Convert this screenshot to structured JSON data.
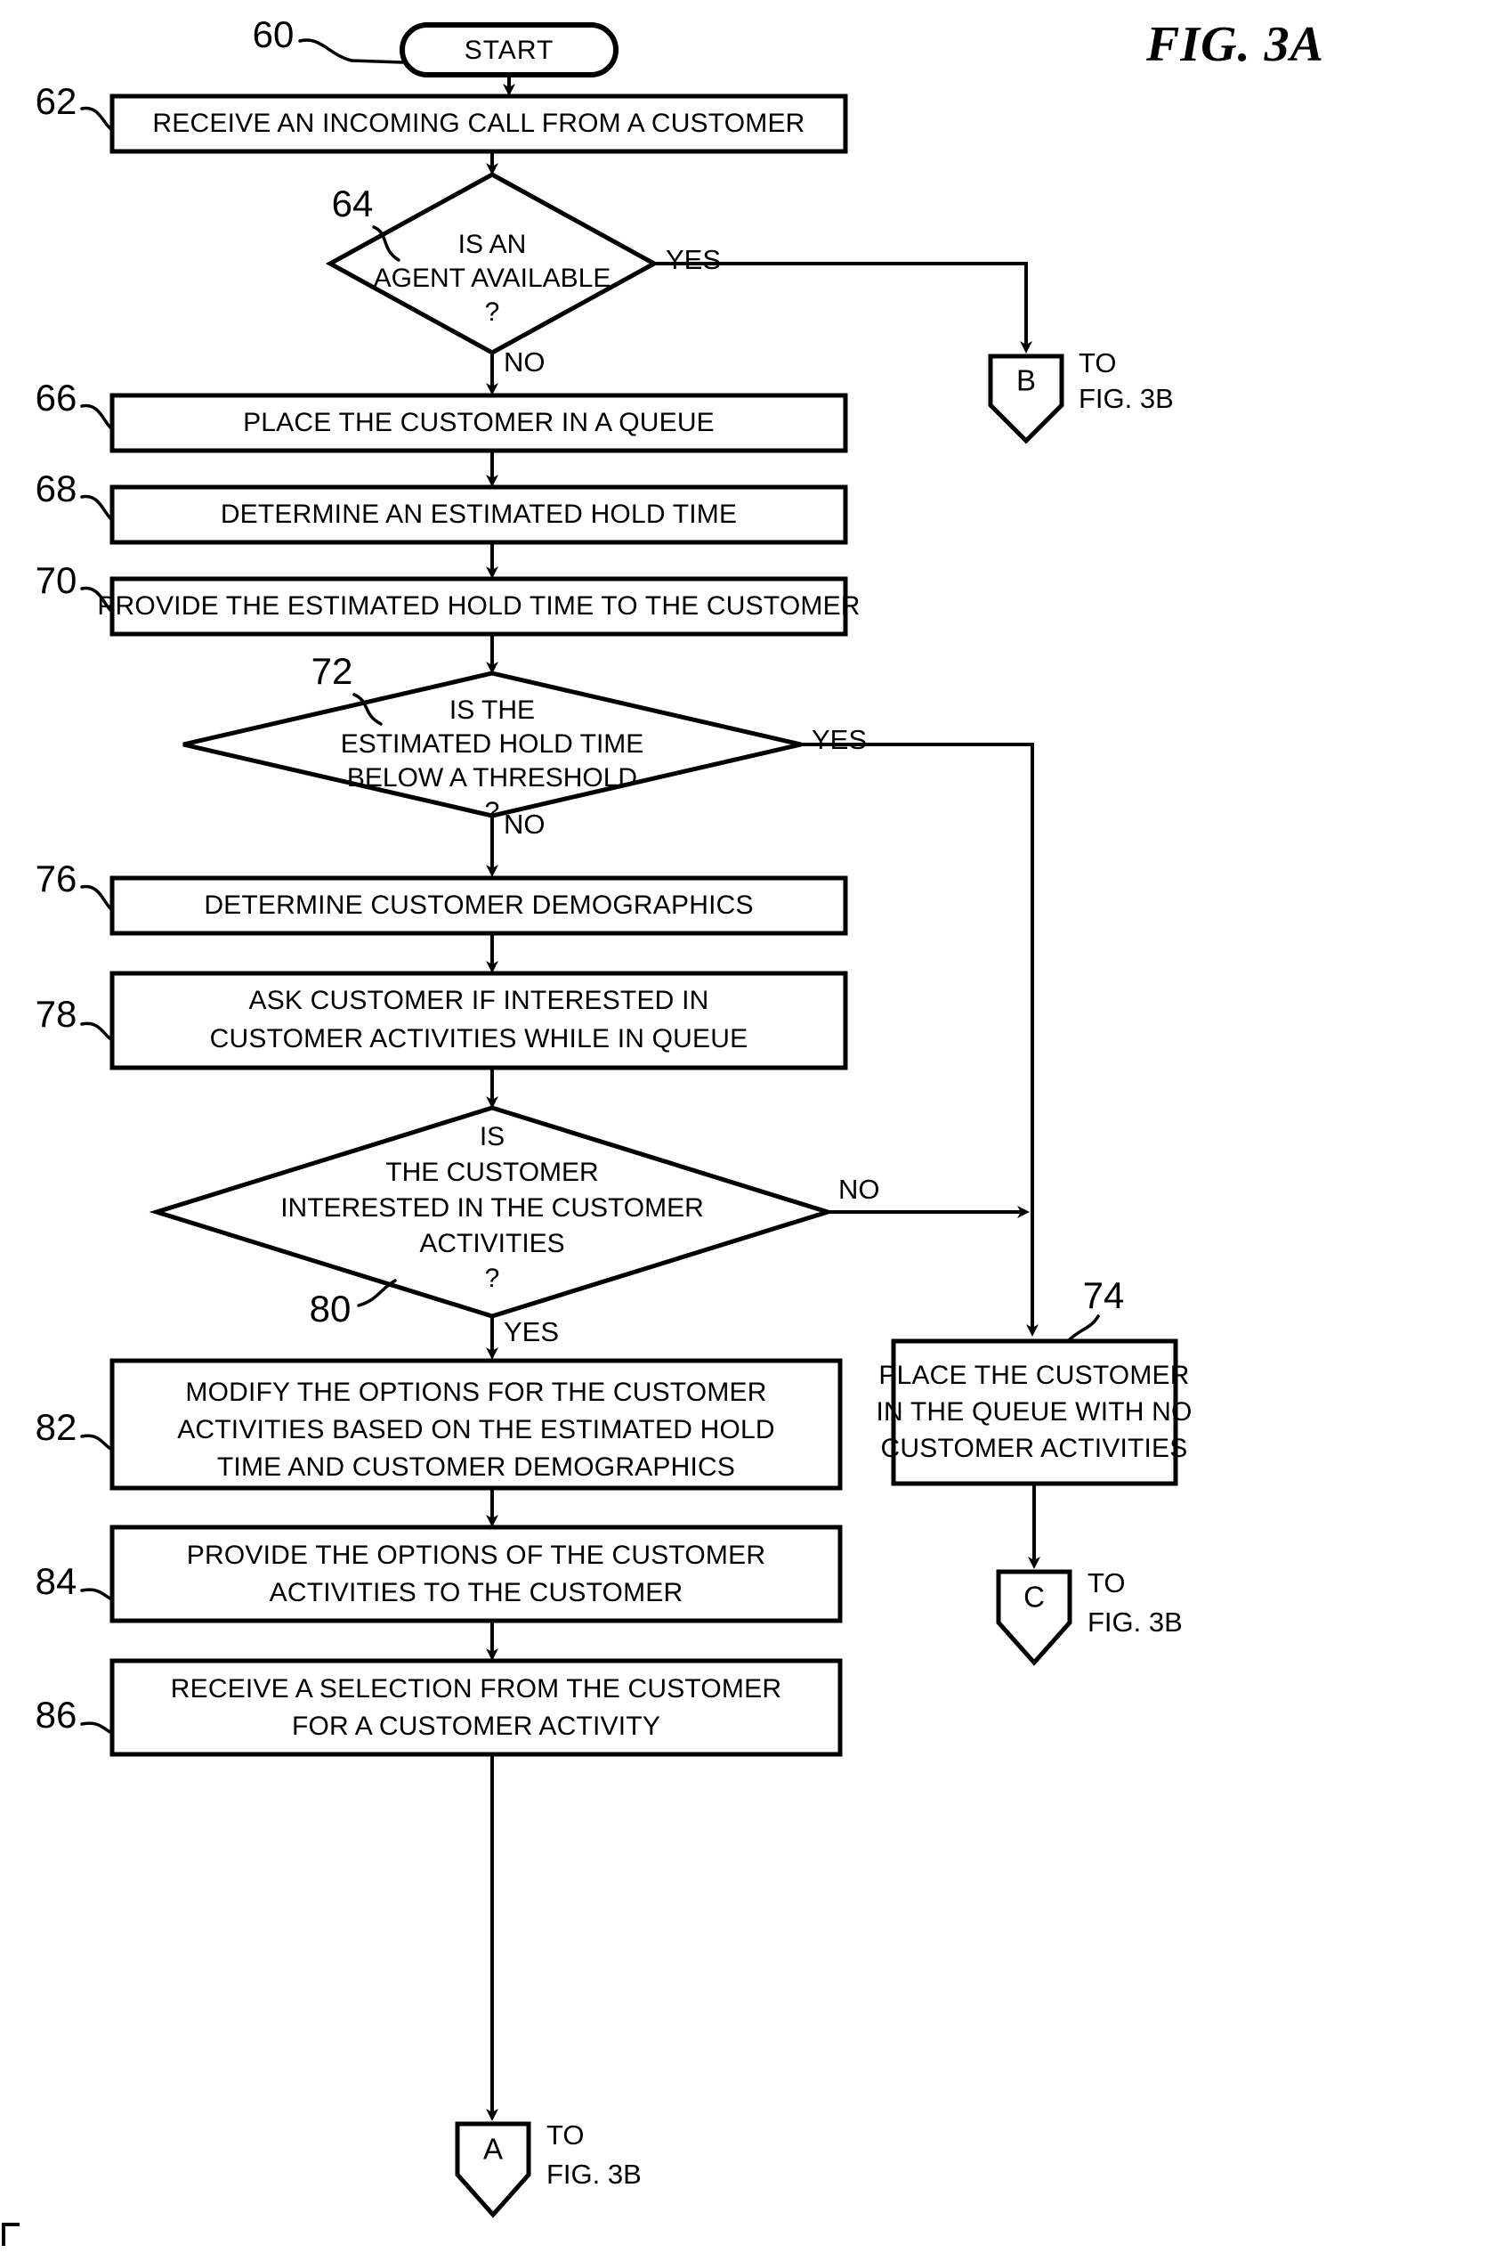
{
  "figure": {
    "title": "FIG. 3A",
    "page_edge_mark": true
  },
  "nodes": {
    "start": {
      "ref": "60",
      "type": "terminal",
      "label": "START"
    },
    "n62": {
      "ref": "62",
      "type": "process",
      "lines": [
        "RECEIVE AN INCOMING CALL FROM A CUSTOMER"
      ]
    },
    "n64": {
      "ref": "64",
      "type": "decision",
      "lines": [
        "IS AN",
        "AGENT AVAILABLE",
        "?"
      ],
      "branch_yes": "YES",
      "branch_no": "NO"
    },
    "n66": {
      "ref": "66",
      "type": "process",
      "lines": [
        "PLACE THE CUSTOMER IN A QUEUE"
      ]
    },
    "n68": {
      "ref": "68",
      "type": "process",
      "lines": [
        "DETERMINE AN ESTIMATED HOLD TIME"
      ]
    },
    "n70": {
      "ref": "70",
      "type": "process",
      "lines": [
        "PROVIDE THE ESTIMATED HOLD TIME TO THE CUSTOMER"
      ]
    },
    "n72": {
      "ref": "72",
      "type": "decision",
      "lines": [
        "IS THE",
        "ESTIMATED HOLD TIME",
        "BELOW A THRESHOLD",
        "?"
      ],
      "branch_yes": "YES",
      "branch_no": "NO"
    },
    "n76": {
      "ref": "76",
      "type": "process",
      "lines": [
        "DETERMINE CUSTOMER DEMOGRAPHICS"
      ]
    },
    "n78": {
      "ref": "78",
      "type": "process",
      "lines": [
        "ASK CUSTOMER IF INTERESTED IN",
        "CUSTOMER ACTIVITIES WHILE IN QUEUE"
      ]
    },
    "n80": {
      "ref": "80",
      "type": "decision",
      "lines": [
        "IS",
        "THE CUSTOMER",
        "INTERESTED IN THE CUSTOMER",
        "ACTIVITIES",
        "?"
      ],
      "branch_yes": "YES",
      "branch_no": "NO"
    },
    "n82": {
      "ref": "82",
      "type": "process",
      "lines": [
        "MODIFY THE OPTIONS FOR THE CUSTOMER",
        "ACTIVITIES BASED ON THE ESTIMATED HOLD",
        "TIME AND CUSTOMER DEMOGRAPHICS"
      ]
    },
    "n84": {
      "ref": "84",
      "type": "process",
      "lines": [
        "PROVIDE THE OPTIONS OF THE CUSTOMER",
        "ACTIVITIES TO THE CUSTOMER"
      ]
    },
    "n86": {
      "ref": "86",
      "type": "process",
      "lines": [
        "RECEIVE A SELECTION FROM THE CUSTOMER",
        "FOR A CUSTOMER ACTIVITY"
      ]
    },
    "n74": {
      "ref": "74",
      "type": "process",
      "lines": [
        "PLACE THE CUSTOMER",
        "IN THE QUEUE WITH NO",
        "CUSTOMER ACTIVITIES"
      ]
    }
  },
  "connectors": {
    "b": {
      "letter": "B",
      "goto_line1": "TO",
      "goto_line2": "FIG. 3B"
    },
    "c": {
      "letter": "C",
      "goto_line1": "TO",
      "goto_line2": "FIG. 3B"
    },
    "a": {
      "letter": "A",
      "goto_line1": "TO",
      "goto_line2": "FIG. 3B"
    }
  },
  "colors": {
    "ink": "#000000",
    "paper": "#ffffff"
  }
}
